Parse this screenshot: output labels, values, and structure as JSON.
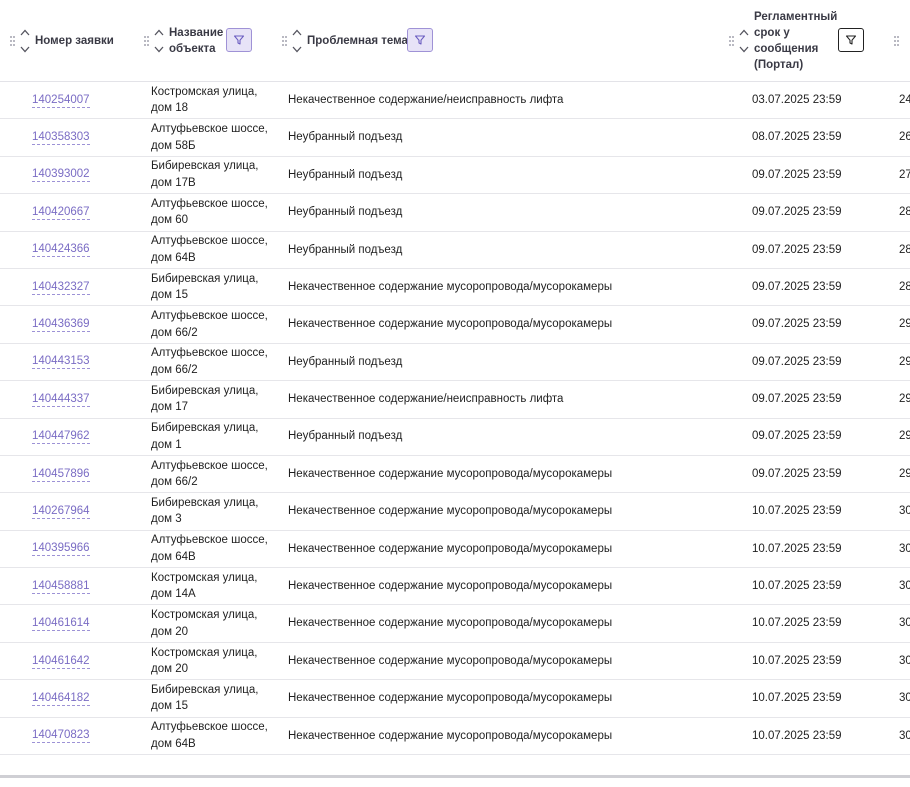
{
  "columns": [
    {
      "label": "Номер заявки"
    },
    {
      "label": "Название объекта"
    },
    {
      "label": "Проблемная тема"
    },
    {
      "label": "Регламентный срок у сообщения (Портал)"
    }
  ],
  "colors": {
    "link": "#7a6cc4",
    "filter_active_bg": "#e7e3f7",
    "filter_active_border": "#9f92d6"
  },
  "rows": [
    {
      "id": "140254007",
      "object": "Костромская улица, дом 18",
      "topic": "Некачественное содержание/неисправность лифта",
      "deadline": "03.07.2025 23:59",
      "next": "24"
    },
    {
      "id": "140358303",
      "object": "Алтуфьевское шоссе, дом 58Б",
      "topic": "Неубранный подъезд",
      "deadline": "08.07.2025 23:59",
      "next": "26"
    },
    {
      "id": "140393002",
      "object": "Бибиревская улица, дом 17В",
      "topic": "Неубранный подъезд",
      "deadline": "09.07.2025 23:59",
      "next": "27"
    },
    {
      "id": "140420667",
      "object": "Алтуфьевское шоссе, дом 60",
      "topic": "Неубранный подъезд",
      "deadline": "09.07.2025 23:59",
      "next": "28"
    },
    {
      "id": "140424366",
      "object": "Алтуфьевское шоссе, дом 64В",
      "topic": "Неубранный подъезд",
      "deadline": "09.07.2025 23:59",
      "next": "28"
    },
    {
      "id": "140432327",
      "object": "Бибиревская улица, дом 15",
      "topic": "Некачественное содержание мусоропровода/мусорокамеры",
      "deadline": "09.07.2025 23:59",
      "next": "28"
    },
    {
      "id": "140436369",
      "object": "Алтуфьевское шоссе, дом 66/2",
      "topic": "Некачественное содержание мусоропровода/мусорокамеры",
      "deadline": "09.07.2025 23:59",
      "next": "29"
    },
    {
      "id": "140443153",
      "object": "Алтуфьевское шоссе, дом 66/2",
      "topic": "Неубранный подъезд",
      "deadline": "09.07.2025 23:59",
      "next": "29"
    },
    {
      "id": "140444337",
      "object": "Бибиревская улица, дом 17",
      "topic": "Некачественное содержание/неисправность лифта",
      "deadline": "09.07.2025 23:59",
      "next": "29"
    },
    {
      "id": "140447962",
      "object": "Бибиревская улица, дом 1",
      "topic": "Неубранный подъезд",
      "deadline": "09.07.2025 23:59",
      "next": "29"
    },
    {
      "id": "140457896",
      "object": "Алтуфьевское шоссе, дом 66/2",
      "topic": "Некачественное содержание мусоропровода/мусорокамеры",
      "deadline": "09.07.2025 23:59",
      "next": "29"
    },
    {
      "id": "140267964",
      "object": "Бибиревская улица, дом 3",
      "topic": "Некачественное содержание мусоропровода/мусорокамеры",
      "deadline": "10.07.2025 23:59",
      "next": "30"
    },
    {
      "id": "140395966",
      "object": "Алтуфьевское шоссе, дом 64В",
      "topic": "Некачественное содержание мусоропровода/мусорокамеры",
      "deadline": "10.07.2025 23:59",
      "next": "30"
    },
    {
      "id": "140458881",
      "object": "Костромская улица, дом 14А",
      "topic": "Некачественное содержание мусоропровода/мусорокамеры",
      "deadline": "10.07.2025 23:59",
      "next": "30"
    },
    {
      "id": "140461614",
      "object": "Костромская улица, дом 20",
      "topic": "Некачественное содержание мусоропровода/мусорокамеры",
      "deadline": "10.07.2025 23:59",
      "next": "30"
    },
    {
      "id": "140461642",
      "object": "Костромская улица, дом 20",
      "topic": "Некачественное содержание мусоропровода/мусорокамеры",
      "deadline": "10.07.2025 23:59",
      "next": "30"
    },
    {
      "id": "140464182",
      "object": "Бибиревская улица, дом 15",
      "topic": "Некачественное содержание мусоропровода/мусорокамеры",
      "deadline": "10.07.2025 23:59",
      "next": "30"
    },
    {
      "id": "140470823",
      "object": "Алтуфьевское шоссе, дом 64В",
      "topic": "Некачественное содержание мусоропровода/мусорокамеры",
      "deadline": "10.07.2025 23:59",
      "next": "30"
    }
  ]
}
